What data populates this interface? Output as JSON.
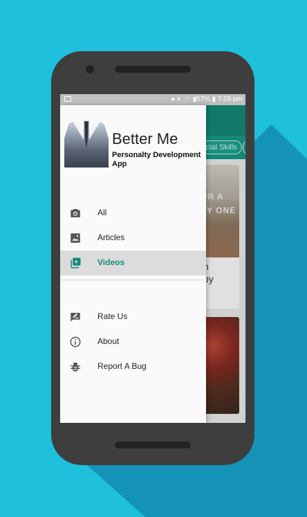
{
  "status_bar": {
    "battery": "57%",
    "time": "7:09 pm"
  },
  "background_app": {
    "tab_label": "Social Skills",
    "card1_image_text_line1": "OR A",
    "card1_image_text_line2": "PY ONE",
    "card1_title_line1": "n",
    "card1_title_line2": "by"
  },
  "drawer": {
    "app_name": "Better Me",
    "app_subtitle": "Personalty Development App",
    "primary_items": [
      {
        "label": "All",
        "icon": "camera-icon"
      },
      {
        "label": "Articles",
        "icon": "image-icon"
      },
      {
        "label": "Videos",
        "icon": "video-library-icon",
        "active": true
      }
    ],
    "secondary_items": [
      {
        "label": "Rate Us",
        "icon": "rate-icon"
      },
      {
        "label": "About",
        "icon": "info-icon"
      },
      {
        "label": "Report A Bug",
        "icon": "bug-icon"
      }
    ]
  },
  "colors": {
    "background": "#1ec0dc",
    "accent": "#14897a",
    "phone_body": "#3e3e3e"
  }
}
